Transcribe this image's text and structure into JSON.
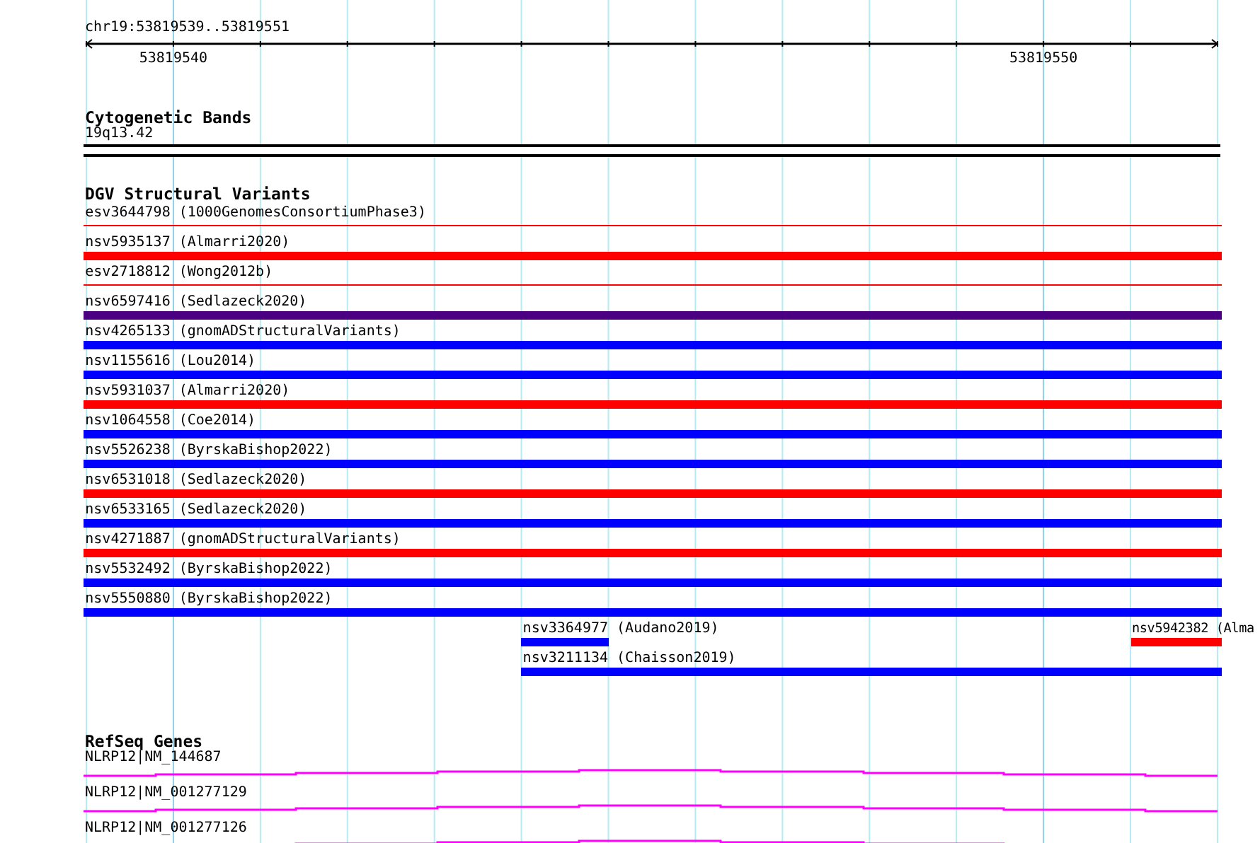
{
  "ruler": {
    "location": "chr19:53819539..53819551",
    "ticks": [
      "53819540",
      "53819550"
    ]
  },
  "tracks": [
    {
      "kind": "cytoband",
      "title": "Cytogenetic Bands",
      "band": "19q13.42"
    },
    {
      "kind": "variants",
      "title": "DGV Structural Variants",
      "rows": [
        {
          "features": [
            {
              "label": "esv3644798 (1000GenomesConsortiumPhase3)",
              "color": "#ff0000",
              "kind": "line"
            }
          ]
        },
        {
          "features": [
            {
              "label": "nsv5935137 (Almarri2020)",
              "color": "#ff0000",
              "kind": "bar"
            }
          ]
        },
        {
          "features": [
            {
              "label": "esv2718812 (Wong2012b)",
              "color": "#ff0000",
              "kind": "line"
            }
          ]
        },
        {
          "features": [
            {
              "label": "nsv6597416 (Sedlazeck2020)",
              "color": "#4b0082",
              "kind": "bar"
            }
          ]
        },
        {
          "features": [
            {
              "label": "nsv4265133 (gnomADStructuralVariants)",
              "color": "#0000ff",
              "kind": "bar"
            }
          ]
        },
        {
          "features": [
            {
              "label": "nsv1155616 (Lou2014)",
              "color": "#0000ff",
              "kind": "bar"
            }
          ]
        },
        {
          "features": [
            {
              "label": "nsv5931037 (Almarri2020)",
              "color": "#ff0000",
              "kind": "bar"
            }
          ]
        },
        {
          "features": [
            {
              "label": "nsv1064558 (Coe2014)",
              "color": "#0000ff",
              "kind": "bar"
            }
          ]
        },
        {
          "features": [
            {
              "label": "nsv5526238 (ByrskaBishop2022)",
              "color": "#0000ff",
              "kind": "bar"
            }
          ]
        },
        {
          "features": [
            {
              "label": "nsv6531018 (Sedlazeck2020)",
              "color": "#ff0000",
              "kind": "bar"
            }
          ]
        },
        {
          "features": [
            {
              "label": "nsv6533165 (Sedlazeck2020)",
              "color": "#0000ff",
              "kind": "bar"
            }
          ]
        },
        {
          "features": [
            {
              "label": "nsv4271887 (gnomADStructuralVariants)",
              "color": "#ff0000",
              "kind": "bar"
            }
          ]
        },
        {
          "features": [
            {
              "label": "nsv5532492 (ByrskaBishop2022)",
              "color": "#0000ff",
              "kind": "bar"
            }
          ]
        },
        {
          "features": [
            {
              "label": "nsv5550880 (ByrskaBishop2022)",
              "color": "#0000ff",
              "kind": "bar"
            }
          ]
        },
        {
          "features": [
            {
              "label": "nsv3364977 (Audano2019)",
              "color": "#0000ff",
              "kind": "bar"
            },
            {
              "label": "nsv5942382 (Alma",
              "color": "#ff0000",
              "kind": "bar"
            }
          ]
        },
        {
          "features": [
            {
              "label": "nsv3211134 (Chaisson2019)",
              "color": "#0000ff",
              "kind": "bar"
            }
          ]
        }
      ]
    },
    {
      "kind": "genes",
      "title": "RefSeq Genes",
      "genes": [
        {
          "label": "NLRP12|NM_144687"
        },
        {
          "label": "NLRP12|NM_001277129"
        },
        {
          "label": "NLRP12|NM_001277126"
        }
      ]
    }
  ]
}
